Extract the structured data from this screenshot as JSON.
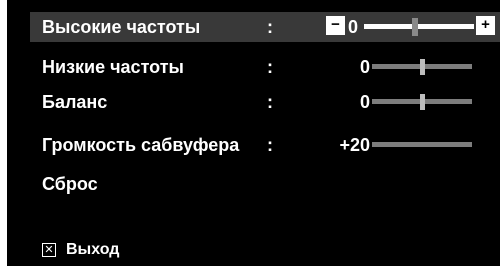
{
  "menu": {
    "items": [
      {
        "label": "Высокие частоты",
        "colon": ":",
        "value": "0",
        "level": 0.5,
        "selected": true
      },
      {
        "label": "Низкие частоты",
        "colon": ":",
        "value": "0",
        "level": 0.5,
        "selected": false
      },
      {
        "label": "Баланс",
        "colon": ":",
        "value": "0",
        "level": 0.5,
        "selected": false
      },
      {
        "label": "Громкость сабвуфера",
        "colon": ":",
        "value": "+20",
        "level": null,
        "selected": false
      },
      {
        "label": "Сброс"
      }
    ],
    "adjust": {
      "minus": "−",
      "plus": "+"
    }
  },
  "footer": {
    "exit_icon": "✕",
    "exit_label": "Выход"
  },
  "colors": {
    "background": "#000000",
    "selected_row": "#393939",
    "text": "#ffffff",
    "slider_track": "#7d7d7d"
  }
}
